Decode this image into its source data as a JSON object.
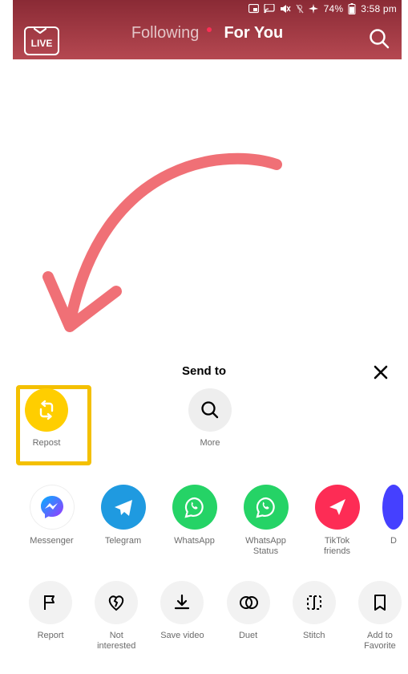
{
  "status": {
    "battery": "74%",
    "time": "3:58 pm"
  },
  "live": {
    "label": "LIVE"
  },
  "nav": {
    "following": "Following",
    "for_you": "For You"
  },
  "share": {
    "title": "Send to",
    "internal": {
      "repost": "Repost",
      "more": "More"
    },
    "apps": {
      "messenger": "Messenger",
      "telegram": "Telegram",
      "whatsapp": "WhatsApp",
      "whatsapp_status": "WhatsApp\nStatus",
      "tiktok_friends": "TikTok\nfriends",
      "partial": "D"
    },
    "actions": {
      "report": "Report",
      "not_interested": "Not\ninterested",
      "save_video": "Save video",
      "duet": "Duet",
      "stitch": "Stitch",
      "add_fav": "Add to\nFavorite"
    }
  }
}
